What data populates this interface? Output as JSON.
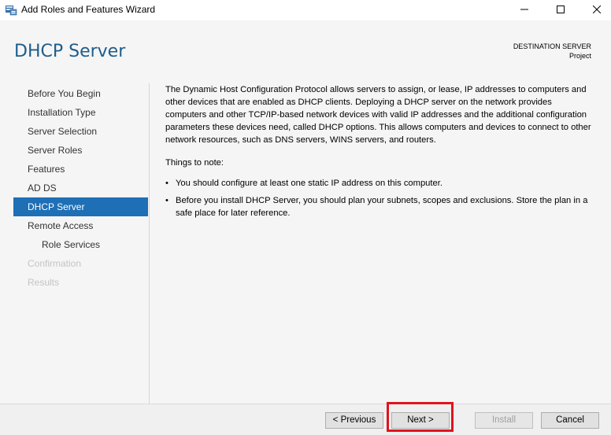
{
  "window": {
    "title": "Add Roles and Features Wizard"
  },
  "header": {
    "page_title": "DHCP Server",
    "destination_label": "DESTINATION SERVER",
    "destination_value": "Project"
  },
  "nav": {
    "items": [
      {
        "label": "Before You Begin",
        "state": "normal"
      },
      {
        "label": "Installation Type",
        "state": "normal"
      },
      {
        "label": "Server Selection",
        "state": "normal"
      },
      {
        "label": "Server Roles",
        "state": "normal"
      },
      {
        "label": "Features",
        "state": "normal"
      },
      {
        "label": "AD DS",
        "state": "normal"
      },
      {
        "label": "DHCP Server",
        "state": "active"
      },
      {
        "label": "Remote Access",
        "state": "normal"
      },
      {
        "label": "Role Services",
        "state": "sub"
      },
      {
        "label": "Confirmation",
        "state": "disabled"
      },
      {
        "label": "Results",
        "state": "disabled"
      }
    ]
  },
  "main": {
    "intro": "The Dynamic Host Configuration Protocol allows servers to assign, or lease, IP addresses to computers and other devices that are enabled as DHCP clients. Deploying a DHCP server on the network provides computers and other TCP/IP-based network devices with valid IP addresses and the additional configuration parameters these devices need, called DHCP options. This allows computers and devices to connect to other network resources, such as DNS servers, WINS servers, and routers.",
    "notes_heading": "Things to note:",
    "notes": [
      "You should configure at least one static IP address on this computer.",
      "Before you install DHCP Server, you should plan your subnets, scopes and exclusions. Store the plan in a safe place for later reference."
    ],
    "bullet": "•"
  },
  "footer": {
    "previous_label": "< Previous",
    "next_label": "Next >",
    "install_label": "Install",
    "cancel_label": "Cancel"
  },
  "colors": {
    "accent": "#1e6fb6",
    "title_blue": "#1e5d8c",
    "highlight": "#e0141e"
  },
  "icons": {
    "app": "server-manager-icon",
    "minimize": "minimize-icon",
    "maximize": "maximize-icon",
    "close": "close-icon"
  }
}
